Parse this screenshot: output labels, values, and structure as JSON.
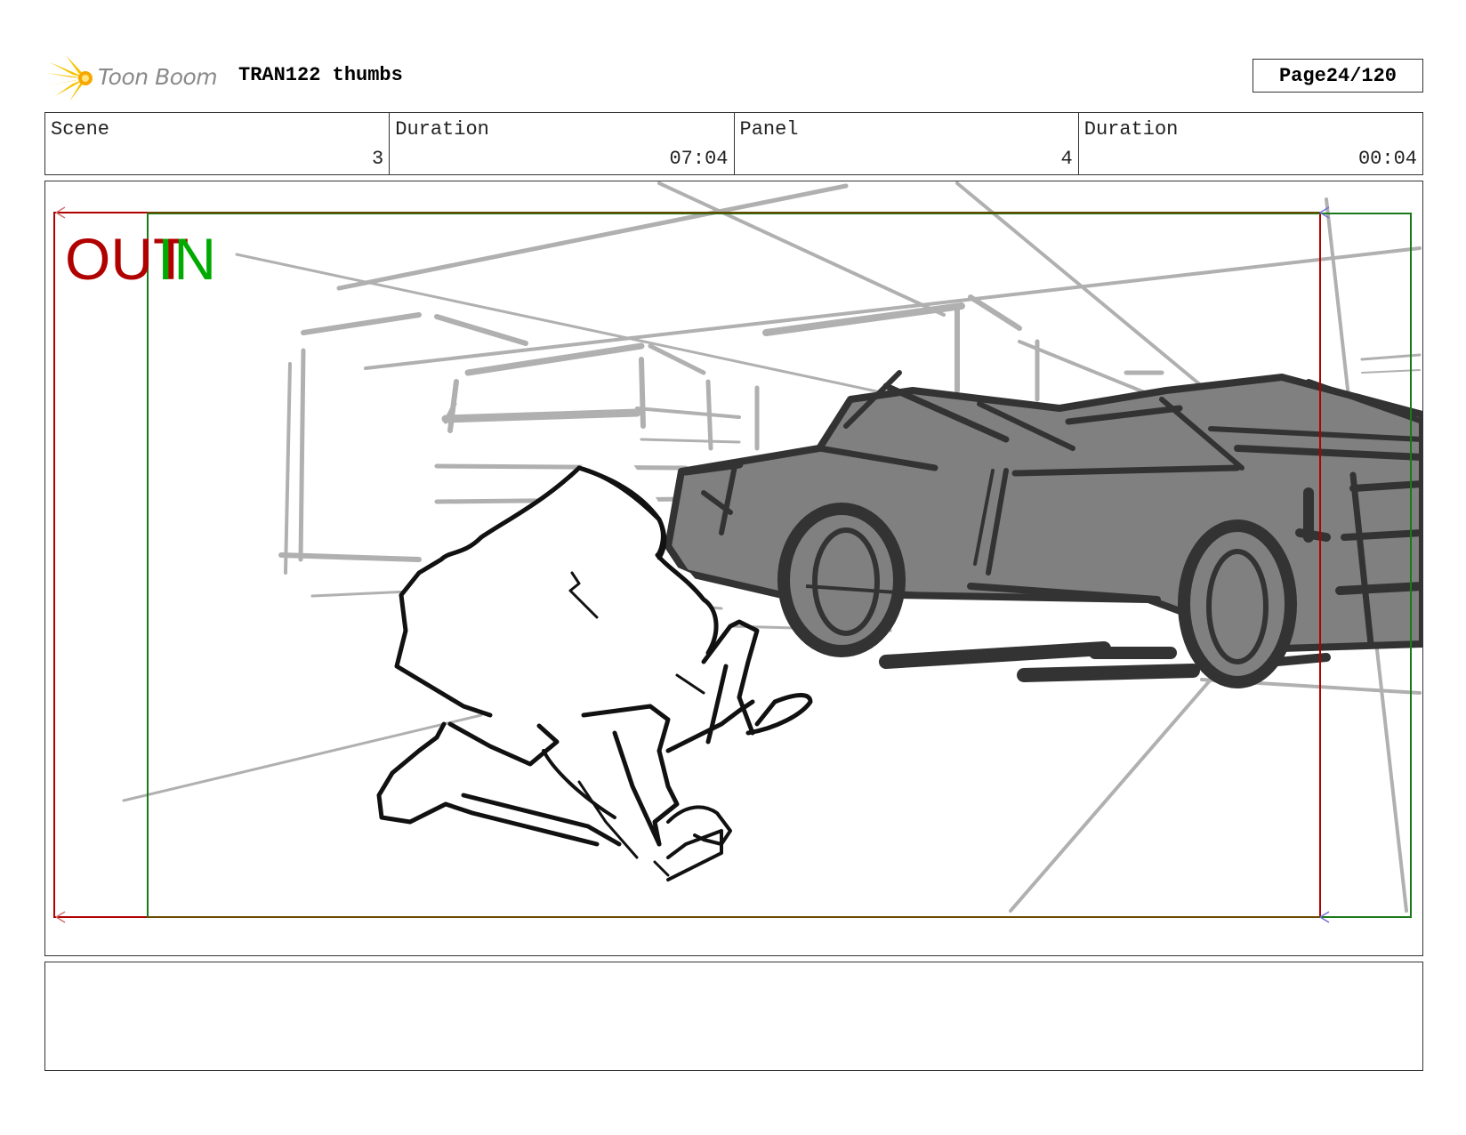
{
  "header": {
    "logo_text": "Toon Boom",
    "title": "TRAN122 thumbs",
    "page_label": "Page",
    "page_value": "24/120"
  },
  "info": {
    "scene_label": "Scene",
    "scene_value": "3",
    "scene_duration_label": "Duration",
    "scene_duration_value": "07:04",
    "panel_label": "Panel",
    "panel_value": "4",
    "panel_duration_label": "Duration",
    "panel_duration_value": "00:04"
  },
  "panel_markers": {
    "out_label": "OUT",
    "in_label": "IN",
    "out_color": "#b00000",
    "in_color": "#00aa00"
  },
  "colors": {
    "sketch_gray": "#b0b0b0",
    "car_fill": "#808080",
    "ink": "#333333",
    "logo_yellow": "#f5c400"
  },
  "notes": {
    "text": ""
  }
}
